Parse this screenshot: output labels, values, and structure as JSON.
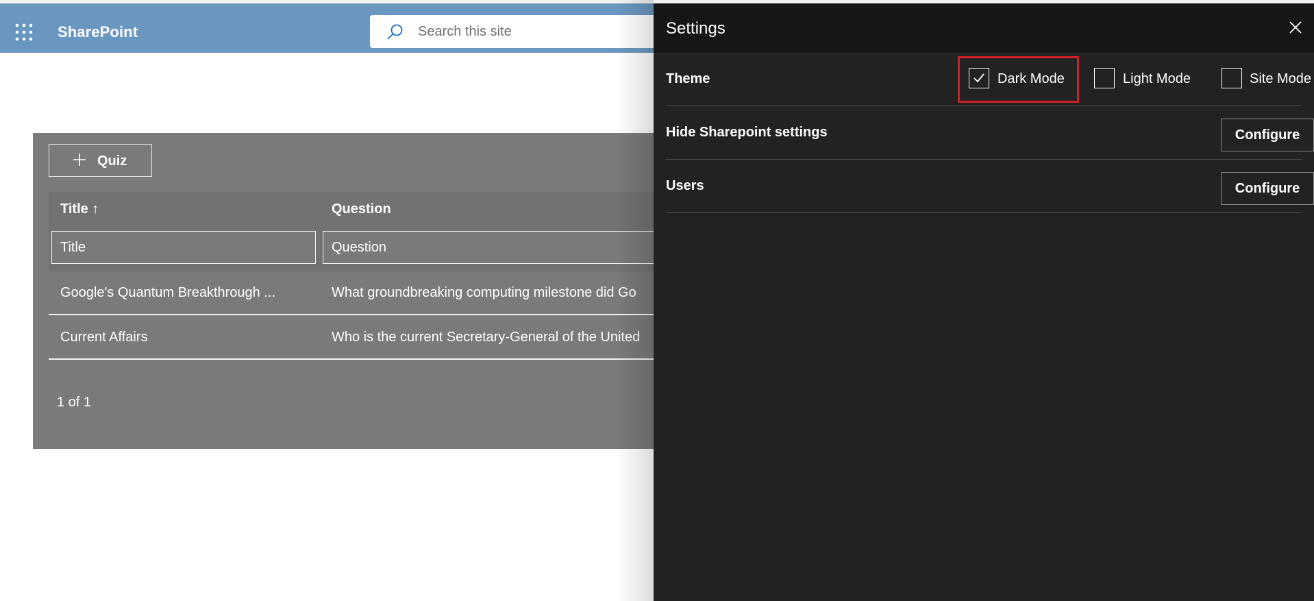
{
  "suite_bar": {
    "app_name": "SharePoint",
    "search_placeholder": "Search this site",
    "icons": [
      "app-launcher-icon",
      "search-icon"
    ]
  },
  "quiz_list": {
    "new_button_label": "Quiz",
    "columns": [
      {
        "label": "Title ↑",
        "filter_placeholder": "Title"
      },
      {
        "label": "Question",
        "filter_placeholder": "Question"
      }
    ],
    "rows": [
      {
        "title": "Google's Quantum Breakthrough ...",
        "question": "What groundbreaking computing milestone did Go"
      },
      {
        "title": "Current Affairs",
        "question": "Who is the current Secretary-General of the United"
      }
    ],
    "pagination": "1 of 1"
  },
  "settings_panel": {
    "title": "Settings",
    "theme": {
      "label": "Theme",
      "options": [
        {
          "label": "Dark Mode",
          "checked": true
        },
        {
          "label": "Light Mode",
          "checked": false
        },
        {
          "label": "Site Mode",
          "checked": false
        }
      ]
    },
    "hide_settings": {
      "label": "Hide Sharepoint settings",
      "button_label": "Configure"
    },
    "users": {
      "label": "Users",
      "button_label": "Configure"
    }
  },
  "colors": {
    "suite_bar": "#6a97bf",
    "panel_background": "#222222",
    "panel_header": "#161616",
    "list_background": "#7a7a7a",
    "highlight": "#d21e25"
  }
}
